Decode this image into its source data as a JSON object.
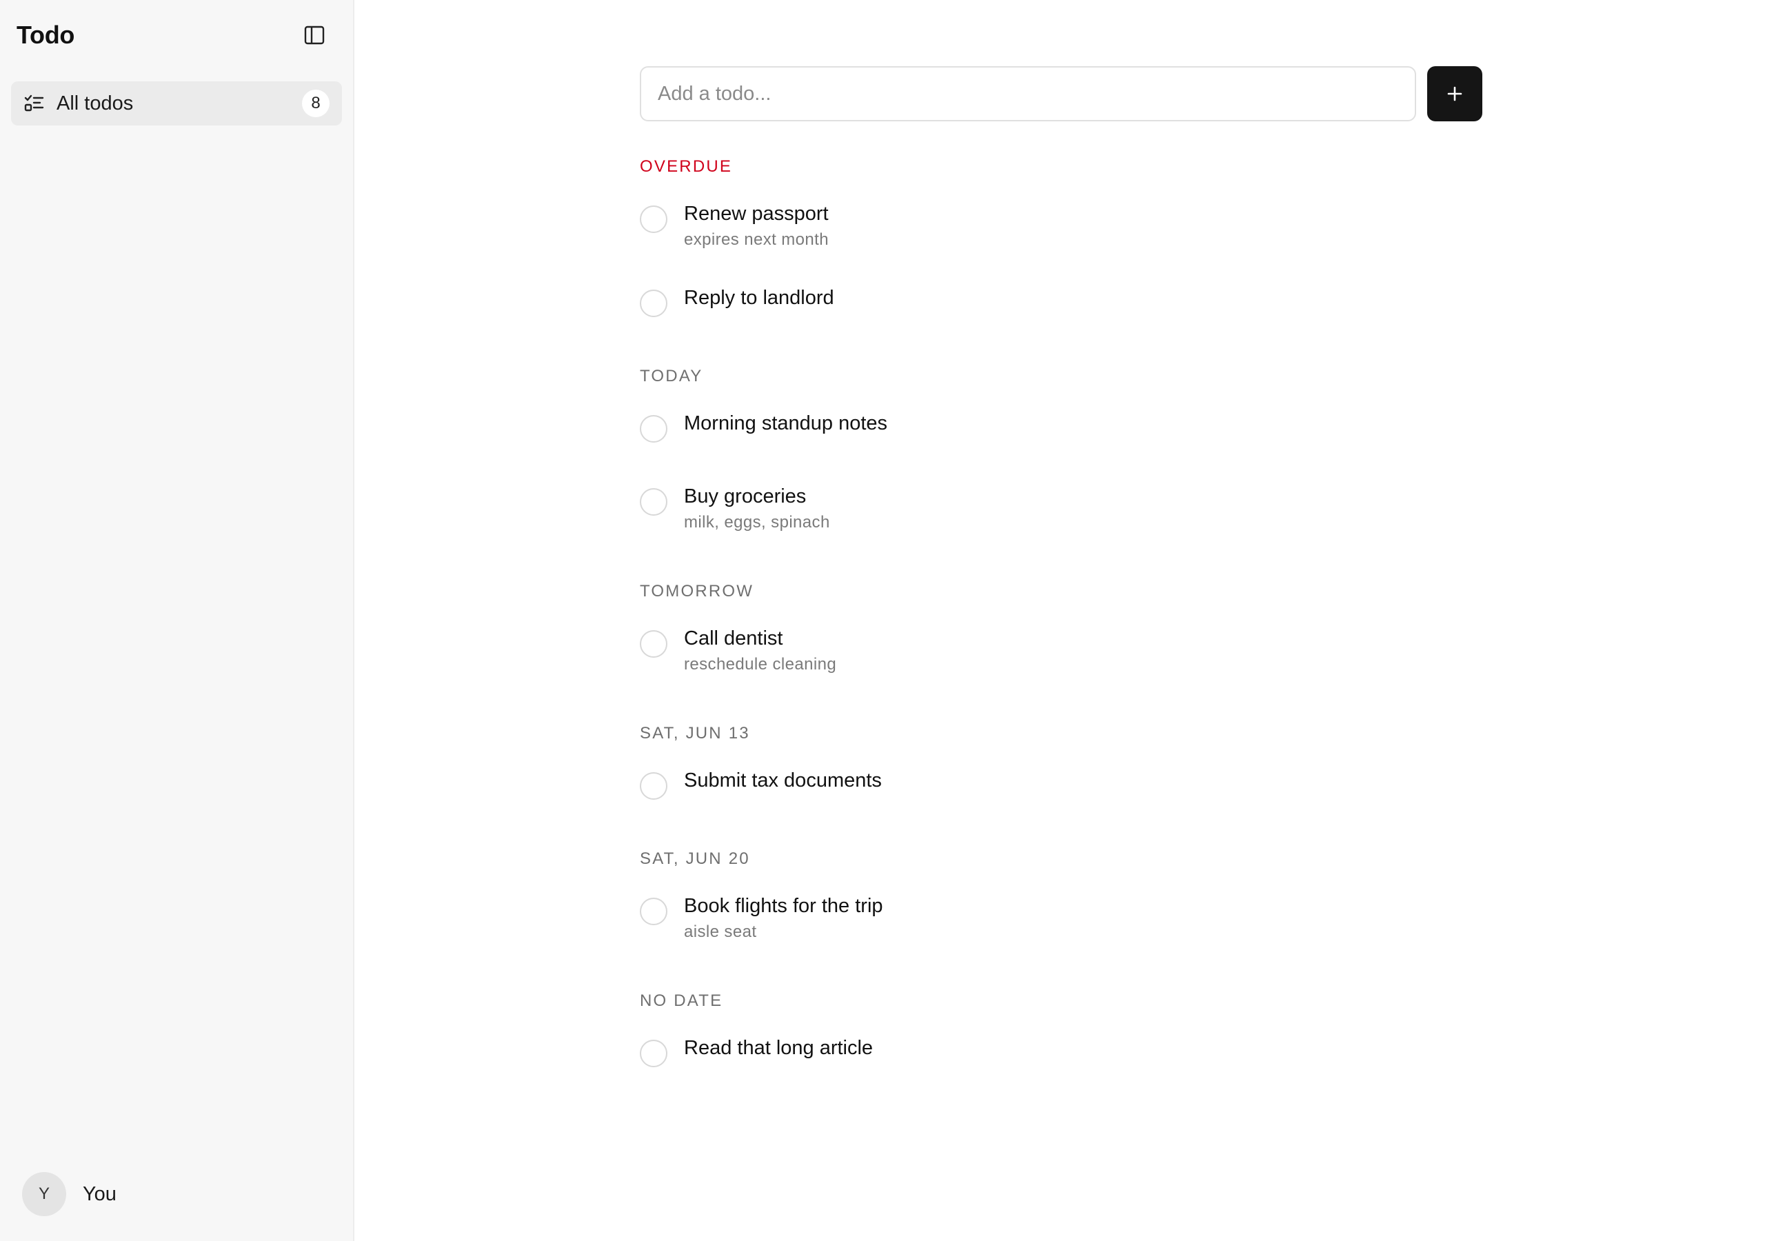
{
  "sidebar": {
    "title": "Todo",
    "nav": [
      {
        "label": "All todos",
        "count": "8"
      }
    ],
    "user": {
      "initial": "Y",
      "name": "You"
    }
  },
  "composer": {
    "placeholder": "Add a todo...",
    "add_icon": "plus-icon"
  },
  "sections": [
    {
      "title": "OVERDUE",
      "color": "#d0021b",
      "items": [
        {
          "title": "Renew passport",
          "note": "expires next month"
        },
        {
          "title": "Reply to landlord",
          "note": ""
        }
      ]
    },
    {
      "title": "TODAY",
      "items": [
        {
          "title": "Morning standup notes",
          "note": ""
        },
        {
          "title": "Buy groceries",
          "note": "milk, eggs, spinach"
        }
      ]
    },
    {
      "title": "TOMORROW",
      "items": [
        {
          "title": "Call dentist",
          "note": "reschedule cleaning"
        }
      ]
    },
    {
      "title": "SAT, JUN 13",
      "items": [
        {
          "title": "Submit tax documents",
          "note": ""
        }
      ]
    },
    {
      "title": "SAT, JUN 20",
      "items": [
        {
          "title": "Book flights for the trip",
          "note": "aisle seat"
        }
      ]
    },
    {
      "title": "NO DATE",
      "items": [
        {
          "title": "Read that long article",
          "note": ""
        }
      ]
    }
  ]
}
